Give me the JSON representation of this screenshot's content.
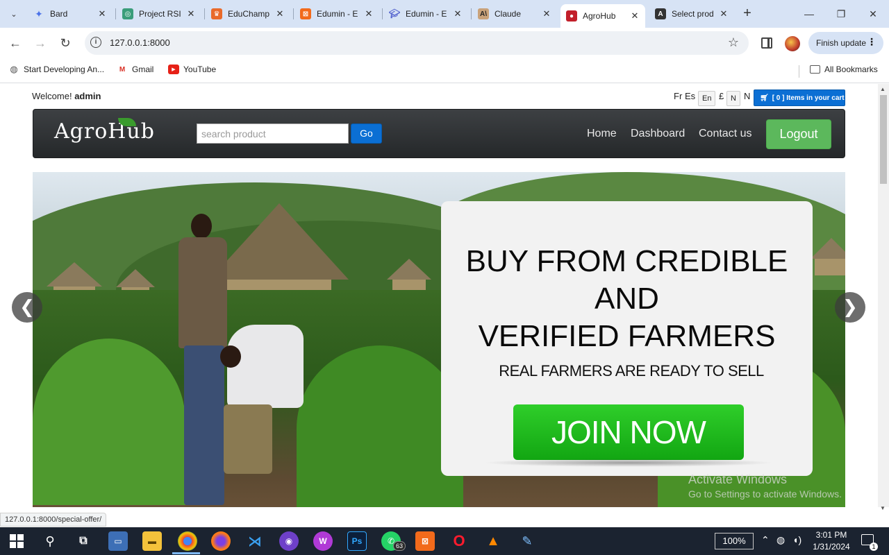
{
  "browser": {
    "tabs": [
      {
        "label": "Bard",
        "active": false,
        "favicon": "bard-icon",
        "color": "#4b72e8"
      },
      {
        "label": "Project RSI",
        "active": false,
        "favicon": "chatgpt-icon",
        "color": "#3a9d7a"
      },
      {
        "label": "EduChamp",
        "active": false,
        "favicon": "educhamp-icon",
        "color": "#e96a2a"
      },
      {
        "label": "Edumin - E",
        "active": false,
        "favicon": "edumin-icon",
        "color": "#f26a1b"
      },
      {
        "label": "Edumin - E",
        "active": false,
        "favicon": "graduation-cap-icon",
        "color": "#5b6ad0"
      },
      {
        "label": "Claude",
        "active": false,
        "favicon": "anthropic-icon",
        "color": "#c9a27a"
      },
      {
        "label": "AgroHub",
        "active": true,
        "favicon": "agrohub-icon",
        "color": "#c21f2a"
      },
      {
        "label": "Select prod",
        "active": false,
        "favicon": "letter-a-icon",
        "color": "#333333"
      }
    ],
    "url": "127.0.0.1:8000",
    "finish_update_label": "Finish update",
    "bookmarks": [
      {
        "label": "Start Developing An...",
        "icon": "globe-icon"
      },
      {
        "label": "Gmail",
        "icon": "gmail-icon"
      },
      {
        "label": "YouTube",
        "icon": "youtube-icon"
      }
    ],
    "all_bookmarks_label": "All Bookmarks",
    "status_url": "127.0.0.1:8000/special-offer/"
  },
  "page": {
    "welcome_prefix": "Welcome!",
    "welcome_user": "admin",
    "lang_fr": "Fr",
    "lang_es": "Es",
    "lang_en": "En",
    "currency_pound": "£",
    "currency_n_btn": "N",
    "currency_n": "N",
    "cart_label": "[ 0 ] Items in your cart",
    "logo_text": "AgroHub",
    "search_placeholder": "search product",
    "go_label": "Go",
    "nav": {
      "home": "Home",
      "dashboard": "Dashboard",
      "contact": "Contact us",
      "logout": "Logout"
    },
    "hero": {
      "line1": "BUY FROM CREDIBLE",
      "line2": "AND",
      "line3": "VERIFIED FARMERS",
      "subtitle": "REAL FARMERS ARE READY TO SELL",
      "cta": "JOIN NOW",
      "prev": "❮",
      "next": "❯"
    },
    "watermark_line1": "Activate Windows",
    "watermark_line2": "Go to Settings to activate Windows."
  },
  "taskbar": {
    "zoom": "100%",
    "time": "3:01 PM",
    "date": "1/31/2024",
    "whatsapp_badge": "63",
    "notification_count": "1"
  }
}
